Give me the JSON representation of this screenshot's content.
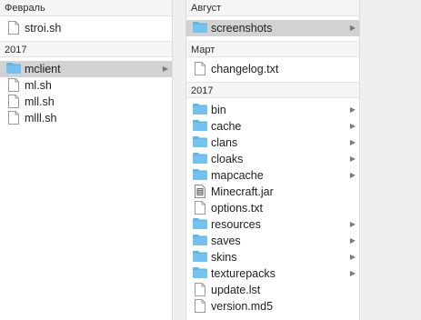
{
  "left_column": {
    "groups": [
      {
        "header": "Февраль",
        "items": [
          {
            "name": "stroi.sh",
            "kind": "doc"
          }
        ]
      },
      {
        "header": "2017",
        "items": [
          {
            "name": "mclient",
            "kind": "folder",
            "selected": true
          },
          {
            "name": "ml.sh",
            "kind": "doc"
          },
          {
            "name": "mll.sh",
            "kind": "doc"
          },
          {
            "name": "mlll.sh",
            "kind": "doc"
          }
        ]
      }
    ]
  },
  "right_column": {
    "groups": [
      {
        "header": "Август",
        "items": [
          {
            "name": "screenshots",
            "kind": "folder",
            "selected": true
          }
        ]
      },
      {
        "header": "Март",
        "items": [
          {
            "name": "changelog.txt",
            "kind": "doc"
          }
        ]
      },
      {
        "header": "2017",
        "items": [
          {
            "name": "bin",
            "kind": "folder"
          },
          {
            "name": "cache",
            "kind": "folder"
          },
          {
            "name": "clans",
            "kind": "folder"
          },
          {
            "name": "cloaks",
            "kind": "folder"
          },
          {
            "name": "mapcache",
            "kind": "folder"
          },
          {
            "name": "Minecraft.jar",
            "kind": "jar"
          },
          {
            "name": "options.txt",
            "kind": "doc"
          },
          {
            "name": "resources",
            "kind": "folder"
          },
          {
            "name": "saves",
            "kind": "folder"
          },
          {
            "name": "skins",
            "kind": "folder"
          },
          {
            "name": "texturepacks",
            "kind": "folder"
          },
          {
            "name": "update.lst",
            "kind": "doc"
          },
          {
            "name": "version.md5",
            "kind": "doc"
          }
        ]
      }
    ]
  },
  "icons": {
    "folder": "folder-icon",
    "doc": "document-icon",
    "jar": "jar-file-icon",
    "chevron": "chevron-right-icon"
  },
  "colors": {
    "folder": "#5fb4ea",
    "selection": "#d2d2d2",
    "header_bg": "#f5f5f5"
  }
}
